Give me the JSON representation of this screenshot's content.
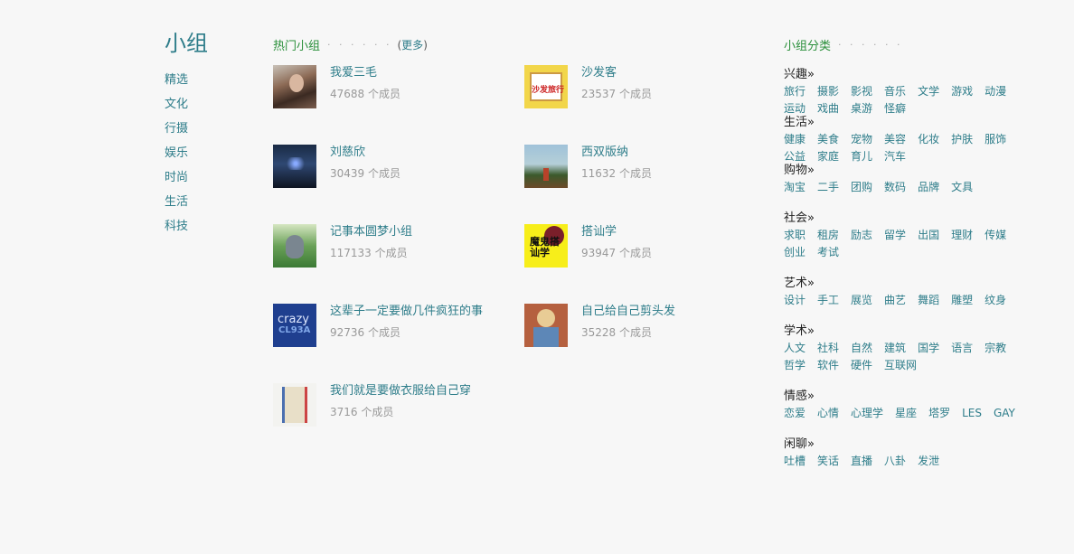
{
  "nav": {
    "title": "小组",
    "items": [
      "精选",
      "文化",
      "行摄",
      "娱乐",
      "时尚",
      "生活",
      "科技"
    ]
  },
  "hot": {
    "title": "热门小组",
    "dots": "· · · · · ·",
    "more_open": "(",
    "more_label": "更多",
    "more_close": ")",
    "groups": [
      {
        "name": "我爱三毛",
        "members": "47688 个成员",
        "icon": "portrait-woman"
      },
      {
        "name": "沙发客",
        "members": "23537 个成员",
        "icon": "sofa-travel-cover"
      },
      {
        "name": "刘慈欣",
        "members": "30439 个成员",
        "icon": "night-sky"
      },
      {
        "name": "西双版纳",
        "members": "11632 个成员",
        "icon": "landscape-tower"
      },
      {
        "name": "记事本圆梦小组",
        "members": "117133 个成员",
        "icon": "totoro"
      },
      {
        "name": "搭讪学",
        "members": "93947 个成员",
        "icon": "book-cover-yellow"
      },
      {
        "name": "这辈子一定要做几件疯狂的事",
        "members": "92736 个成员",
        "icon": "crazy-life"
      },
      {
        "name": "自己给自己剪头发",
        "members": "35228 个成员",
        "icon": "haircut-illustration"
      },
      {
        "name": "我们就是要做衣服给自己穿",
        "members": "3716 个成员",
        "icon": "clothes"
      }
    ],
    "thumb_text": {
      "sofa": "沙发旅行",
      "dash": "魔鬼搭讪学",
      "crazy1": "crazy",
      "crazy2": "CL93A"
    }
  },
  "cats": {
    "title": "小组分类",
    "dots": "· · · · · ·",
    "blocks": [
      {
        "title": "兴趣»",
        "tags": [
          "旅行",
          "摄影",
          "影视",
          "音乐",
          "文学",
          "游戏",
          "动漫",
          "运动",
          "戏曲",
          "桌游",
          "怪癖"
        ]
      },
      {
        "title": "生活»",
        "tags": [
          "健康",
          "美食",
          "宠物",
          "美容",
          "化妆",
          "护肤",
          "服饰",
          "公益",
          "家庭",
          "育儿",
          "汽车"
        ]
      },
      {
        "title": "购物»",
        "tags": [
          "淘宝",
          "二手",
          "团购",
          "数码",
          "品牌",
          "文具"
        ]
      },
      {
        "title": "社会»",
        "tags": [
          "求职",
          "租房",
          "励志",
          "留学",
          "出国",
          "理财",
          "传媒",
          "创业",
          "考试"
        ]
      },
      {
        "title": "艺术»",
        "tags": [
          "设计",
          "手工",
          "展览",
          "曲艺",
          "舞蹈",
          "雕塑",
          "纹身"
        ]
      },
      {
        "title": "学术»",
        "tags": [
          "人文",
          "社科",
          "自然",
          "建筑",
          "国学",
          "语言",
          "宗教",
          "哲学",
          "软件",
          "硬件",
          "互联网"
        ]
      },
      {
        "title": "情感»",
        "tags": [
          "恋爱",
          "心情",
          "心理学",
          "星座",
          "塔罗",
          "LES",
          "GAY"
        ]
      },
      {
        "title": "闲聊»",
        "tags": [
          "吐槽",
          "笑话",
          "直播",
          "八卦",
          "发泄"
        ]
      }
    ]
  }
}
